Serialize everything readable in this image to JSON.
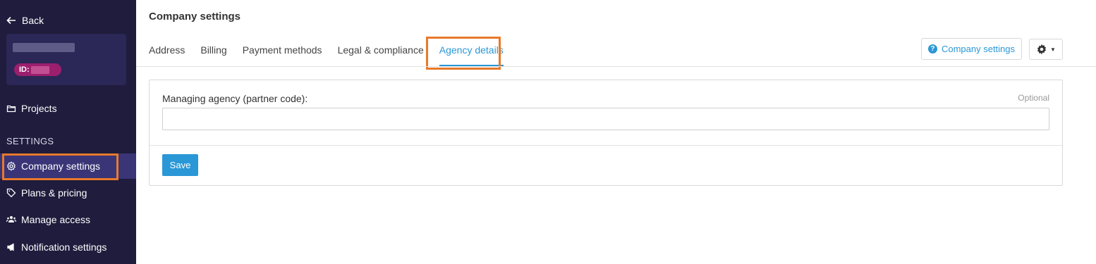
{
  "sidebar": {
    "back_label": "Back",
    "account": {
      "id_prefix": "ID:"
    },
    "projects_label": "Projects",
    "section_label": "SETTINGS",
    "items": [
      {
        "label": "Company settings",
        "icon": "gear-icon",
        "active": true
      },
      {
        "label": "Plans & pricing",
        "icon": "tag-icon"
      },
      {
        "label": "Manage access",
        "icon": "users-icon"
      },
      {
        "label": "Notification settings",
        "icon": "megaphone-icon"
      }
    ]
  },
  "header": {
    "title": "Company settings",
    "tabs": [
      {
        "label": "Address"
      },
      {
        "label": "Billing"
      },
      {
        "label": "Payment methods"
      },
      {
        "label": "Legal & compliance"
      },
      {
        "label": "Agency details",
        "active": true
      }
    ],
    "help_button_label": "Company settings"
  },
  "form": {
    "field_label": "Managing agency (partner code):",
    "optional_label": "Optional",
    "input_value": "",
    "save_label": "Save"
  },
  "colors": {
    "sidebar_bg": "#1f1c3d",
    "accent": "#2a97d6",
    "highlight": "#e8792b",
    "id_badge": "#9c1f6e"
  }
}
